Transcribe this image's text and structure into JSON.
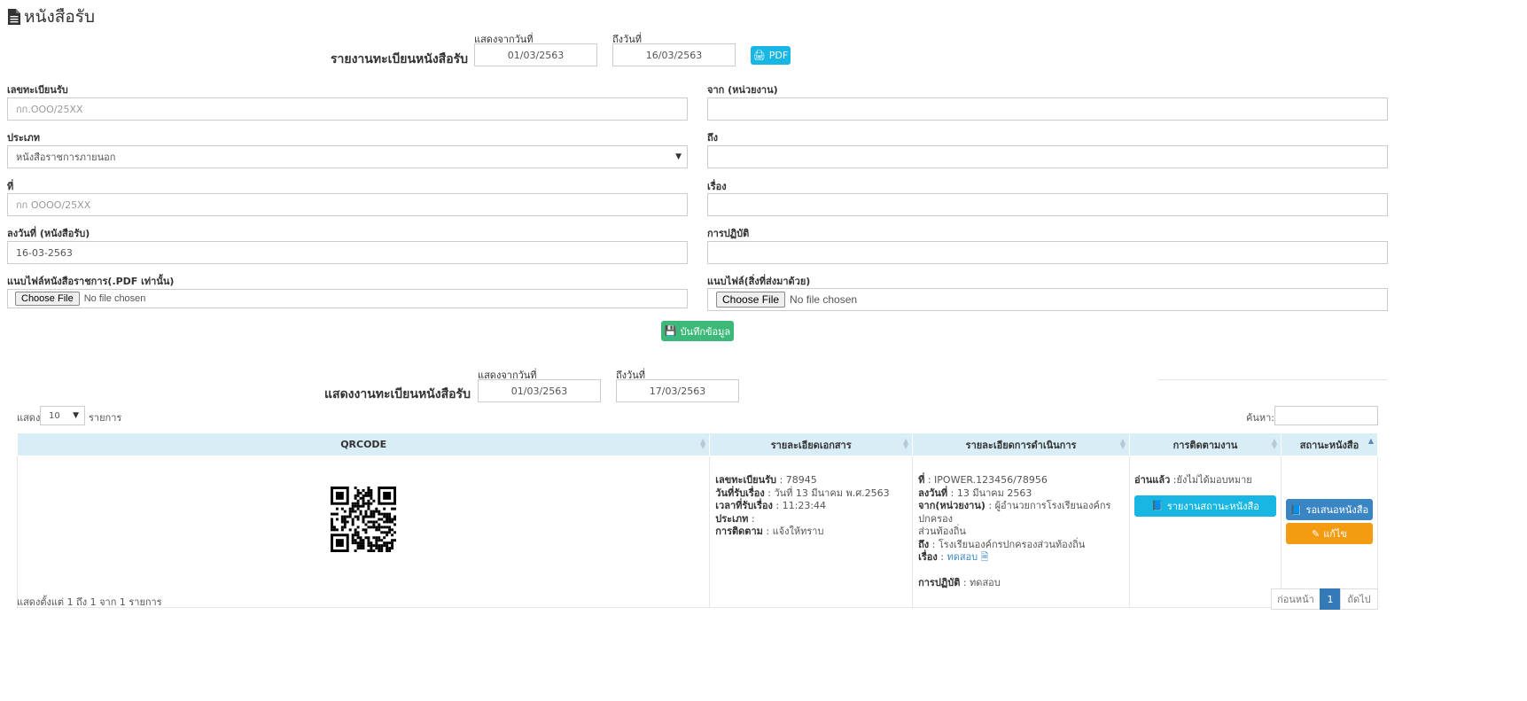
{
  "page": {
    "title": "หนังสือรับ"
  },
  "report": {
    "title": "รายงานทะเบียนหนังสือรับ",
    "from_label": "แสดงจากวันที่",
    "from_value": "01/03/2563",
    "to_label": "ถึงวันที่",
    "to_value": "16/03/2563",
    "pdf_label": "PDF"
  },
  "form": {
    "reg_no": {
      "label": "เลขทะเบียนรับ",
      "placeholder": "กก.OOO/25XX"
    },
    "from_agency": {
      "label": "จาก (หน่วยงาน)",
      "value": ""
    },
    "type": {
      "label": "ประเภท",
      "value": "หนังสือราชการภายนอก"
    },
    "to": {
      "label": "ถึง",
      "value": ""
    },
    "ref_no": {
      "label": "ที่",
      "placeholder": "กก OOOO/25XX"
    },
    "subject": {
      "label": "เรื่อง",
      "value": ""
    },
    "doc_date": {
      "label": "ลงวันที่ (หนังสือรับ)",
      "value": "16-03-2563"
    },
    "action": {
      "label": "การปฏิบัติ",
      "value": ""
    },
    "file_main": {
      "label": "แนบไฟล์หนังสือราชการ(.PDF เท่านั้น)",
      "button": "Choose File",
      "status": "No file chosen"
    },
    "file_attach": {
      "label": "แนบไฟล์(สิ่งที่ส่งมาด้วย)",
      "button": "Choose File",
      "status": "No file chosen"
    },
    "save_label": "บันทึกข้อมูล"
  },
  "listing": {
    "title": "แสดงงานทะเบียนหนังสือรับ",
    "from_label": "แสดงจากวันที่",
    "from_value": "01/03/2563",
    "to_label": "ถึงวันที่",
    "to_value": "17/03/2563",
    "show_label": "แสดง",
    "page_size": "10",
    "items_label": "รายการ",
    "search_label": "ค้นหา:",
    "columns": [
      "QRCODE",
      "รายละเอียดเอกสาร",
      "รายละเอียดการดำเนินการ",
      "การติดตามงาน",
      "สถานะหนังสือ"
    ],
    "row": {
      "doc": [
        {
          "k": "เลขทะเบียนรับ",
          "v": " : 78945"
        },
        {
          "k": "วันที่รับเรื่อง",
          "v": " : วันที่ 13 มีนาคม พ.ศ.2563"
        },
        {
          "k": "เวลาที่รับเรื่อง",
          "v": " : 11:23:44"
        },
        {
          "k": "ประเภท",
          "v": " :"
        },
        {
          "k": "การติดตาม",
          "v": " : แจ้งให้ทราบ"
        }
      ],
      "proc_no": {
        "k": "ที่",
        "v": " : IPOWER.123456/78956"
      },
      "proc_date": {
        "k": "ลงวันที่",
        "v": " : 13 มีนาคม 2563"
      },
      "proc_from": {
        "k": "จาก(หน่วยงาน)",
        "v": " : ผู้อำนวยการโรงเรียนองค์กรปกครอง",
        "v2": "ส่วนท้องถิ่น"
      },
      "proc_to": {
        "k": "ถึง",
        "v": " : โรงเรียนองค์กรปกครองส่วนท้องถิ่น"
      },
      "proc_subject": {
        "k": "เรื่อง",
        "sep": " : ",
        "link": "ทดสอบ"
      },
      "proc_action": {
        "k": "การปฏิบัติ",
        "v": " : ทดสอบ"
      },
      "track_key": "อ่านแล้ว",
      "track_val": " :ยังไม่ได้มอบหมาย",
      "track_button": "รายงานสถานะหนังสือ",
      "status_button": "รอเสนอหนังสือ",
      "edit_button": "แก้ไข"
    },
    "info": "แสดงตั้งแต่ 1 ถึง 1 จาก 1 รายการ",
    "pager": {
      "prev": "ก่อนหน้า",
      "current": "1",
      "next": "ถัดไป"
    }
  },
  "colors": {
    "info": "#17b6e3",
    "success": "#3cb878",
    "primary": "#3a86c4",
    "warning": "#f39c12",
    "header_bg": "#d9edf7"
  }
}
